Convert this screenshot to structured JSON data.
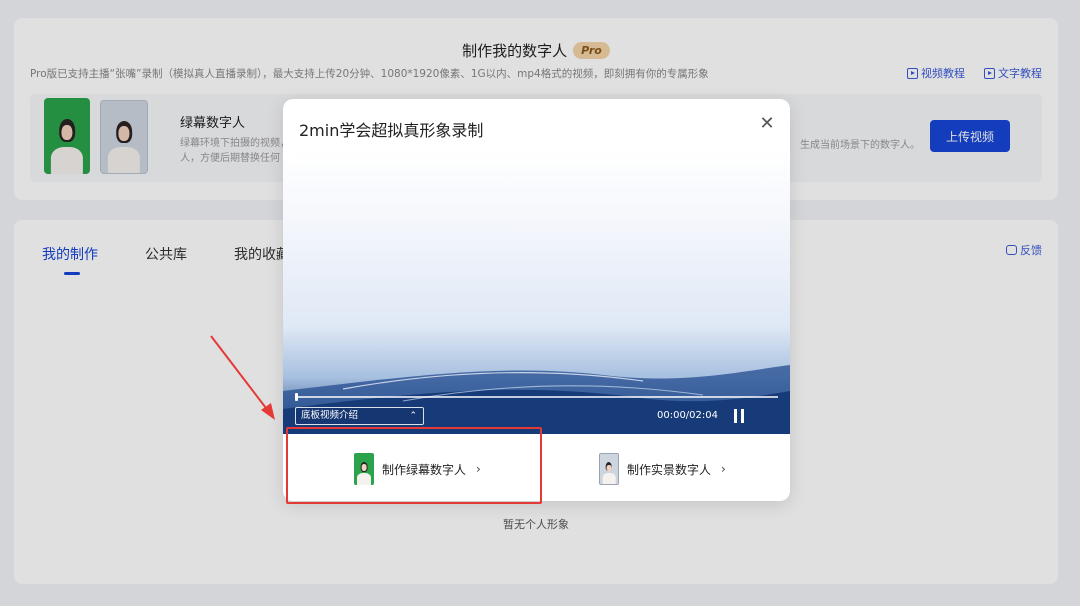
{
  "header": {
    "title": "制作我的数字人",
    "pro_badge": "Pro",
    "subtitle": "Pro版已支持主播“张嘴”录制（模拟真人直播录制），最大支持上传20分钟、1080*1920像素、1G以内、mp4格式的视频，即刻拥有你的专属形象",
    "video_tutorial": "视频教程",
    "text_tutorial": "文字教程"
  },
  "upload_panel": {
    "title": "绿幕数字人",
    "desc": "绿幕环境下拍摄的视频，数字人，方便后期替换任何",
    "desc_right": "生成当前场景下的数字人。",
    "upload_button": "上传视频"
  },
  "tabs": [
    {
      "label": "我的制作",
      "active": true
    },
    {
      "label": "公共库",
      "active": false
    },
    {
      "label": "我的收藏",
      "active": false
    }
  ],
  "feedback_label": "反馈",
  "empty_state": "暂无个人形象",
  "modal": {
    "title": "2min学会超拟真形象录制",
    "close_icon": "close-icon",
    "video": {
      "chapter": "底板视频介绍",
      "time": "00:00/02:04",
      "progress": 0.0
    },
    "options": [
      {
        "label": "制作绿幕数字人",
        "icon": "green-screen-avatar-thumb"
      },
      {
        "label": "制作实景数字人",
        "icon": "real-scene-avatar-thumb"
      }
    ]
  },
  "colors": {
    "primary": "#1746d8",
    "annotation_red": "#e53935",
    "green_screen": "#2aa34a"
  }
}
